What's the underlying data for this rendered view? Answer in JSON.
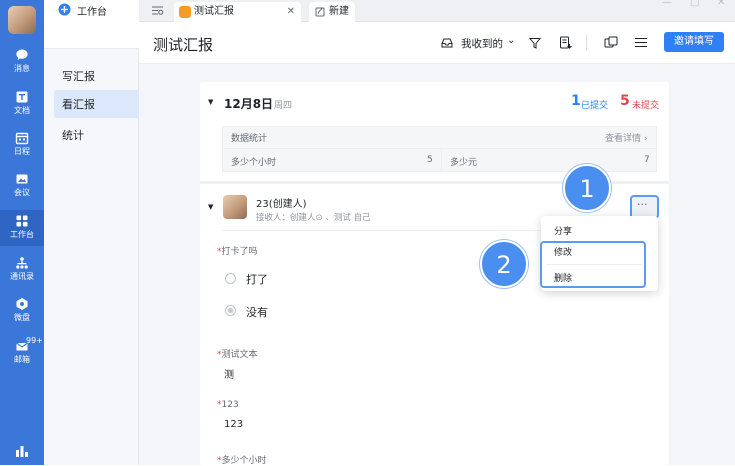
{
  "rail": {
    "items": [
      {
        "label": "消息",
        "icon": "chat-icon"
      },
      {
        "label": "文档",
        "icon": "document-icon"
      },
      {
        "label": "日程",
        "icon": "calendar-icon"
      },
      {
        "label": "会议",
        "icon": "meeting-icon"
      },
      {
        "label": "工作台",
        "icon": "grid-icon"
      },
      {
        "label": "通讯录",
        "icon": "contacts-icon"
      },
      {
        "label": "微盘",
        "icon": "drive-icon"
      },
      {
        "label": "邮箱",
        "icon": "mail-icon",
        "badge": "99+"
      }
    ]
  },
  "nav": {
    "workspace_title": "工作台",
    "items": [
      "写汇报",
      "看汇报",
      "统计"
    ]
  },
  "tabs": {
    "active": "测试汇报",
    "new_tab": "新建"
  },
  "header": {
    "title": "测试汇报",
    "filter_label": "我收到的",
    "invite_button": "邀请填写"
  },
  "day": {
    "date": "12月8日",
    "weekday": "周四",
    "submitted_count": "1",
    "submitted_label": "已提交",
    "unsubmitted_count": "5",
    "unsubmitted_label": "未提交"
  },
  "stats": {
    "title": "数据统计",
    "link": "查看详情",
    "cells": [
      {
        "label": "多少个小时",
        "value": "5"
      },
      {
        "label": "多少元",
        "value": "7"
      }
    ]
  },
  "report": {
    "author": "23(创建人)",
    "receivers": "接收人：创建人⊙ 、测试 自己",
    "q1_label": "打卡了吗",
    "q1_options": [
      "打了",
      "没有"
    ],
    "q2_label": "测试文本",
    "q2_value": "测",
    "q3_label": "123",
    "q3_value": "123",
    "q4_label": "多少个小时"
  },
  "menu": {
    "items": [
      "分享",
      "修改",
      "删除"
    ]
  },
  "callouts": [
    "1",
    "2"
  ],
  "colors": {
    "accent": "#2f7ff6",
    "rail": "#3a77d8",
    "submitted": "#2f7ff6",
    "unsubmitted": "#e04848"
  }
}
